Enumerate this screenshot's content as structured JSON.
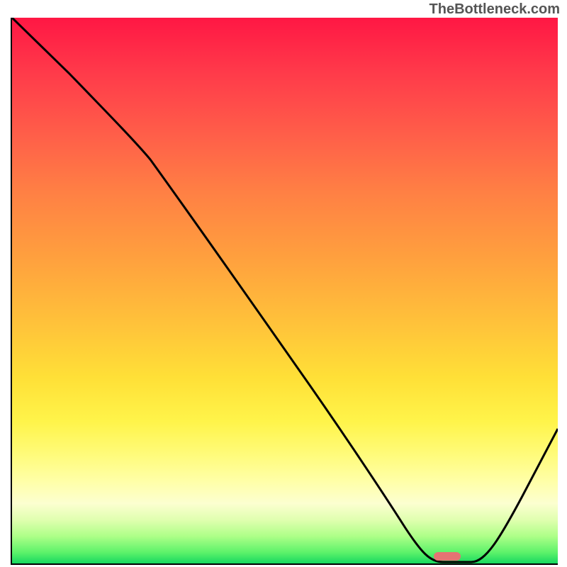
{
  "watermark": "TheBottleneck.com",
  "chart_data": {
    "type": "line",
    "title": "",
    "xlabel": "",
    "ylabel": "",
    "xlim": [
      0,
      100
    ],
    "ylim": [
      0,
      100
    ],
    "series": [
      {
        "name": "curve",
        "x": [
          0,
          10,
          25,
          40,
          55,
          68,
          74,
          80,
          85,
          100
        ],
        "y": [
          100,
          90,
          75,
          55,
          35,
          14,
          3,
          0,
          0,
          25
        ],
        "color": "#000000"
      }
    ],
    "marker": {
      "x_center": 80,
      "y": 0,
      "color": "#e57373"
    },
    "gradient": {
      "top": "#ff1744",
      "mid": "#ffe037",
      "low": "#ffffa8",
      "bottom": "#18d860"
    }
  }
}
